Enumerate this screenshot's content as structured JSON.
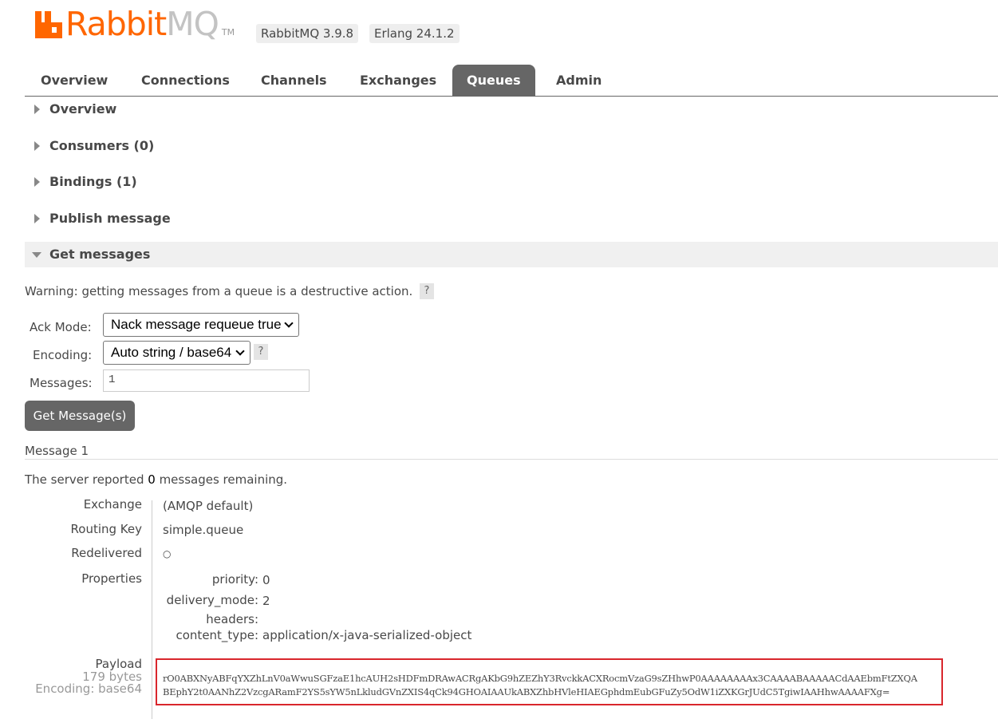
{
  "brand": {
    "name_main": "Rabbit",
    "name_accent": "MQ",
    "tm": "TM"
  },
  "versions": {
    "rabbitmq": "RabbitMQ 3.9.8",
    "erlang": "Erlang 24.1.2"
  },
  "tabs": [
    {
      "label": "Overview",
      "active": false
    },
    {
      "label": "Connections",
      "active": false
    },
    {
      "label": "Channels",
      "active": false
    },
    {
      "label": "Exchanges",
      "active": false
    },
    {
      "label": "Queues",
      "active": true
    },
    {
      "label": "Admin",
      "active": false
    }
  ],
  "sections": {
    "overview": "Overview",
    "consumers": "Consumers (0)",
    "bindings": "Bindings (1)",
    "publish": "Publish message",
    "get": "Get messages"
  },
  "get_form": {
    "warning": "Warning: getting messages from a queue is a destructive action.",
    "help": "?",
    "ack_mode_label": "Ack Mode:",
    "ack_mode_value": "Nack message requeue true",
    "encoding_label": "Encoding:",
    "encoding_value": "Auto string / base64",
    "messages_label": "Messages:",
    "messages_value": "1",
    "button": "Get Message(s)"
  },
  "message": {
    "heading": "Message 1",
    "remaining_prefix": "The server reported ",
    "remaining_count": "0",
    "remaining_suffix": " messages remaining.",
    "exchange_label": "Exchange",
    "exchange_value": "(AMQP default)",
    "routing_key_label": "Routing Key",
    "routing_key_value": "simple.queue",
    "redelivered_label": "Redelivered",
    "redelivered_value": "○",
    "properties_label": "Properties",
    "properties": {
      "priority_label": "priority:",
      "priority_value": "0",
      "delivery_mode_label": "delivery_mode:",
      "delivery_mode_value": "2",
      "headers_label": "headers:",
      "headers_value": "",
      "content_type_label": "content_type:",
      "content_type_value": "application/x-java-serialized-object"
    },
    "payload_label": "Payload",
    "payload_size": "179 bytes",
    "payload_encoding": "Encoding: base64",
    "payload_line1": "rO0ABXNyABFqYXZhLnV0aWwuSGFzaE1hcAUH2sHDFmDRAwACRgAKbG9hZEZhY3RvckkACXRocmVzaG9sZHhwP0AAAAAAAAx3CAAAABAAAAACdAAEbmFtZXQA",
    "payload_line2": "BEphY2t0AANhZ2VzcgARamF2YS5sYW5nLkludGVnZXIS4qCk94GHOAIAAUkABXZhbHVleHIAEGphdmEubGFuZy5OdW1iZXKGrJUdC5TgiwIAAHhwAAAAFXg="
  }
}
